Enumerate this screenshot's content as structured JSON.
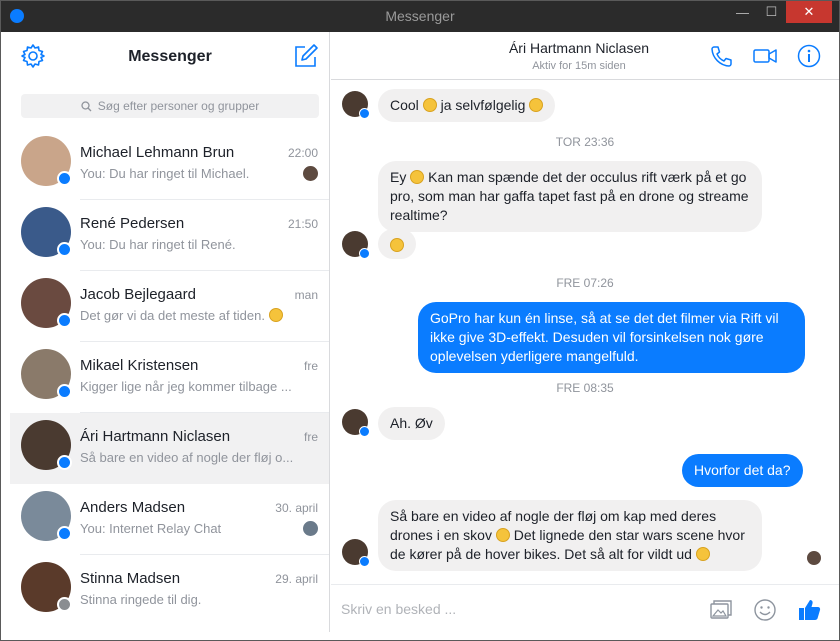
{
  "window": {
    "title": "Messenger",
    "minimize": "—",
    "maximize": "☐",
    "close": "✕"
  },
  "sidebar": {
    "title": "Messenger",
    "search_placeholder": "Søg efter personer og grupper",
    "conversations": [
      {
        "name": "Michael Lehmann Brun",
        "time": "22:00",
        "preview": "You: Du har ringet til Michael.",
        "avatar_color": "#c9a58a",
        "seen": true,
        "active": false,
        "badge": "messenger"
      },
      {
        "name": "René Pedersen",
        "time": "21:50",
        "preview": "You: Du har ringet til René.",
        "avatar_color": "#3a5a8a",
        "seen": false,
        "active": false,
        "badge": "messenger"
      },
      {
        "name": "Jacob Bejlegaard",
        "time": "man",
        "preview": "Det gør vi da det meste af tiden.",
        "avatar_color": "#6a4a40",
        "seen": false,
        "active": false,
        "badge": "messenger",
        "preview_emoji": true
      },
      {
        "name": "Mikael Kristensen",
        "time": "fre",
        "preview": "Kigger lige når jeg kommer tilbage ...",
        "avatar_color": "#8a7a6a",
        "seen": false,
        "active": false,
        "badge": "messenger"
      },
      {
        "name": "Ári Hartmann Niclasen",
        "time": "fre",
        "preview": "Så bare en video af nogle der fløj o...",
        "avatar_color": "#4a3a30",
        "seen": false,
        "active": true,
        "badge": "messenger"
      },
      {
        "name": "Anders Madsen",
        "time": "30. april",
        "preview": "You: Internet Relay Chat",
        "avatar_color": "#7a8a9a",
        "seen": true,
        "active": false,
        "badge": "messenger"
      },
      {
        "name": "Stinna Madsen",
        "time": "29. april",
        "preview": "Stinna ringede til dig.",
        "avatar_color": "#5a3a2a",
        "seen": false,
        "active": false,
        "badge": "facebook"
      }
    ]
  },
  "chat": {
    "contact_name": "Ári Hartmann Niclasen",
    "status": "Aktiv for 15m siden",
    "composer_placeholder": "Skriv en besked ...",
    "messages": {
      "m1": "Cool",
      "m1b": "ja selvfølgelig",
      "ts1": "TOR 23:36",
      "m2a": "Ey",
      "m2b": "Kan man spænde det der occulus rift værk på et go",
      "m2c": "pro, som man har gaffa tapet fast på en drone og streame",
      "m2d": "realtime?",
      "ts2": "FRE 07:26",
      "m3a": "GoPro har kun én linse, så at se det det filmer via Rift vil",
      "m3b": "ikke give 3D-effekt. Desuden vil forsinkelsen nok gøre",
      "m3c": "oplevelsen yderligere mangelfuld.",
      "ts3": "FRE 08:35",
      "m4": "Ah. Øv",
      "m5": "Hvorfor det da?",
      "m6a": "Så bare en video af nogle der fløj om kap med deres",
      "m6b": "drones i en skov",
      "m6c": "Det lignede den star wars scene hvor",
      "m6d": "de kører på de hover bikes. Det så alt for vildt ud"
    }
  },
  "colors": {
    "accent": "#0a7cff",
    "close": "#c7372f",
    "titlebar": "#2b2b2b"
  },
  "icons": {
    "gear": "gear-icon",
    "compose": "compose-icon",
    "search": "search-icon",
    "phone": "phone-icon",
    "video": "video-camera-icon",
    "info": "info-icon",
    "image": "image-icon",
    "emoji": "emoji-icon",
    "like": "thumbs-up-icon"
  }
}
